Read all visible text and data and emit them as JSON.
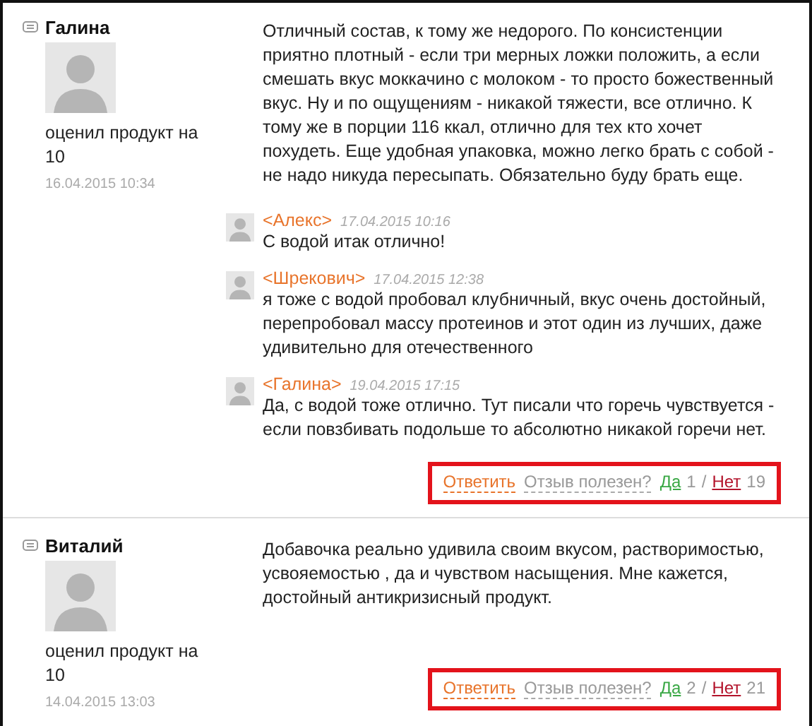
{
  "reviews": [
    {
      "author": "Галина",
      "rating_text": "оценил продукт на 10",
      "date": "16.04.2015 10:34",
      "text": "Отличный состав, к тому же недорого. По консистенции приятно плотный - если три мерных ложки положить, а если смешать вкус моккачино с молоком - то просто божественный вкус. Ну и по ощущениям - никакой тяжести, все отлично. К тому же в порции 116 ккал, отлично для тех кто хочет похудеть. Еще удобная упаковка, можно легко брать с собой - не надо никуда пересыпать. Обязательно буду брать еще.",
      "replies": [
        {
          "author": "<Алекс>",
          "date": "17.04.2015 10:16",
          "text": "С водой итак отлично!"
        },
        {
          "author": "<Шрекович>",
          "date": "17.04.2015 12:38",
          "text": "я тоже с водой пробовал клубничный, вкус очень достойный, перепробовал массу протеинов и этот один из лучших, даже удивительно для отечественного"
        },
        {
          "author": "<Галина>",
          "date": "19.04.2015 17:15",
          "text": "Да, с водой тоже отлично. Тут писали что горечь чувствуется - если повзбивать подольше то абсолютно никакой горечи нет."
        }
      ],
      "actions": {
        "reply": "Ответить",
        "helpful": "Отзыв полезен?",
        "yes": "Да",
        "yes_count": "1",
        "separator": "/",
        "no": "Нет",
        "no_count": "19",
        "highlighted": true
      }
    },
    {
      "author": "Виталий",
      "rating_text": "оценил продукт на 10",
      "date": "14.04.2015 13:03",
      "text": "Добавочка реально удивила своим вкусом, растворимостью, усвояемостью , да и чувством насыщения. Мне кажется, достойный антикризисный продукт.",
      "actions": {
        "reply": "Ответить",
        "helpful": "Отзыв полезен?",
        "yes": "Да",
        "yes_count": "2",
        "separator": "/",
        "no": "Нет",
        "no_count": "21",
        "highlighted": true
      }
    }
  ]
}
